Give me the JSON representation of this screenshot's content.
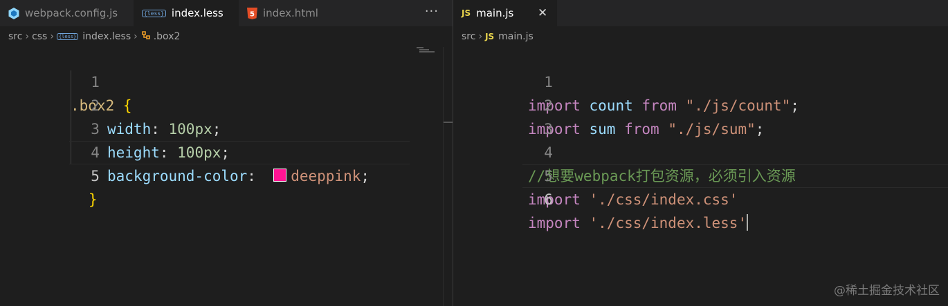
{
  "left_pane": {
    "tabs": [
      {
        "label": "webpack.config.js",
        "icon": "webpack-icon"
      },
      {
        "label": "index.less",
        "icon": "less-icon"
      },
      {
        "label": "index.html",
        "icon": "html5-icon"
      }
    ],
    "more_actions_label": "···",
    "breadcrumb": {
      "src": "src",
      "css": "css",
      "file": "index.less",
      "symbol": ".box2"
    },
    "lines": [
      {
        "num": "1",
        "selector": ".box2",
        "brace": "{"
      },
      {
        "num": "2",
        "prop": "width",
        "value": "100px"
      },
      {
        "num": "3",
        "prop": "height",
        "value": "100px"
      },
      {
        "num": "4",
        "prop": "background-color",
        "value": "deeppink",
        "swatch_color": "#ff1493"
      },
      {
        "num": "5",
        "brace": "}"
      }
    ]
  },
  "right_pane": {
    "tab": {
      "label": "main.js",
      "icon": "js-icon",
      "icon_text": "JS"
    },
    "close_label": "✕",
    "breadcrumb": {
      "src": "src",
      "file": "main.js",
      "icon_text": "JS"
    },
    "lines": [
      {
        "num": "1",
        "kw1": "import",
        "name": "count",
        "kw2": "from",
        "path": "\"./js/count\"",
        "end": ";"
      },
      {
        "num": "2",
        "kw1": "import",
        "name": "sum",
        "kw2": "from",
        "path": "\"./js/sum\"",
        "end": ";"
      },
      {
        "num": "3"
      },
      {
        "num": "4",
        "comment": "//想要webpack打包资源，必须引入资源"
      },
      {
        "num": "5",
        "kw1": "import",
        "path": "'./css/index.css'"
      },
      {
        "num": "6",
        "kw1": "import",
        "path": "'./css/index.less'"
      }
    ]
  },
  "watermark": "@稀土掘金技术社区",
  "colors": {
    "editor_bg": "#1e1e1e",
    "tabbar_bg": "#252526",
    "keyword": "#c586c0",
    "variable": "#9cdcfe",
    "string": "#ce9178",
    "number": "#b5cea8",
    "selector": "#d7ba7d",
    "comment": "#6a9955",
    "deeppink": "#ff1493"
  }
}
